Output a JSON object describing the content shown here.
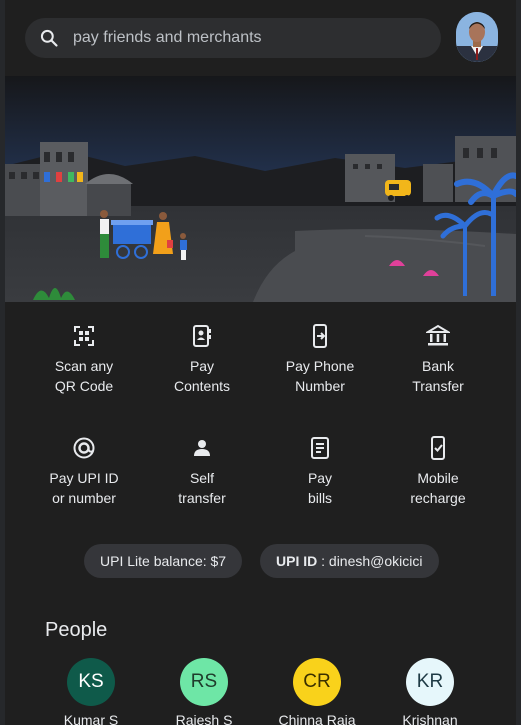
{
  "search": {
    "placeholder": "pay friends and merchants",
    "icon": "search-icon"
  },
  "actions": [
    {
      "line1": "Scan any",
      "line2": "QR Code",
      "icon": "qr-scan-icon"
    },
    {
      "line1": "Pay",
      "line2": "Contents",
      "icon": "contacts-book-icon"
    },
    {
      "line1": "Pay Phone",
      "line2": "Number",
      "icon": "phone-transfer-icon"
    },
    {
      "line1": "Bank",
      "line2": "Transfer",
      "icon": "bank-icon"
    },
    {
      "line1": "Pay UPI ID",
      "line2": "or number",
      "icon": "upi-at-icon"
    },
    {
      "line1": "Self",
      "line2": "transfer",
      "icon": "person-icon"
    },
    {
      "line1": "Pay",
      "line2": "bills",
      "icon": "receipt-icon"
    },
    {
      "line1": "Mobile",
      "line2": "recharge",
      "icon": "mobile-recharge-icon"
    }
  ],
  "chips": {
    "lite": "UPI Lite balance: $7",
    "upi_label": "UPI ID",
    "upi_sep": " : ",
    "upi_value": "dinesh@okicici"
  },
  "people": {
    "title": "People",
    "items": [
      {
        "initials": "KS",
        "name": "Kumar S",
        "bg": "#0f5a4a",
        "fg": "#ffffff"
      },
      {
        "initials": "RS",
        "name": "Rajesh S",
        "bg": "#6ee6a6",
        "fg": "#1f3b2b"
      },
      {
        "initials": "CR",
        "name": "Chinna Raja",
        "bg": "#f9d21b",
        "fg": "#3a3000"
      },
      {
        "initials": "KR",
        "name": "Krishnan",
        "bg": "#e6f7fb",
        "fg": "#1f3b45"
      }
    ]
  },
  "colors": {
    "background": "#1f1f1f",
    "chip": "#35363a",
    "text": "#e8eaed"
  }
}
